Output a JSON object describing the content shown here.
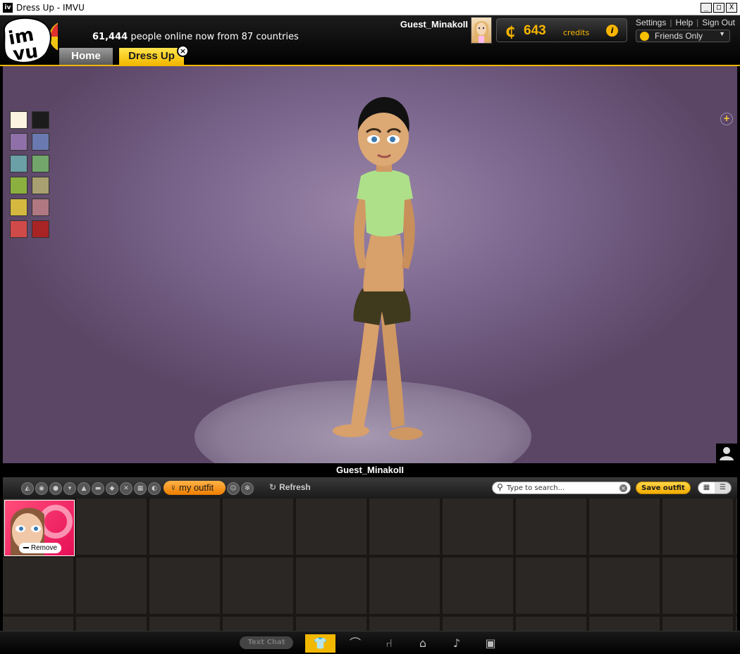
{
  "window": {
    "title": "Dress Up - IMVU",
    "app_icon": "iv",
    "min": "_",
    "max": "□",
    "close": "X"
  },
  "header": {
    "logo_text": "imvu",
    "online_count": "61,444",
    "online_text": "people online now from 87 countries",
    "username": "Guest_MinakoII",
    "credits_symbol": "₵",
    "credits_amount": "643",
    "credits_label": "credits",
    "info_icon": "i",
    "links": [
      "Settings",
      "Help",
      "Sign Out"
    ],
    "status": "Friends Only"
  },
  "tabs": [
    {
      "label": "Home"
    },
    {
      "label": "Dress Up",
      "close": "×"
    }
  ],
  "scene": {
    "swatch_colors": [
      "#fbf4e0",
      "#1c1c1c",
      "#9070a8",
      "#6a7ab0",
      "#6aa0a6",
      "#72a66a",
      "#8cb040",
      "#a8a070",
      "#d4b840",
      "#b07880",
      "#d04a4a",
      "#a82424"
    ],
    "add_button": "+"
  },
  "name_bar": "Guest_MinakoII",
  "toolbar": {
    "category_icons": [
      "hair-icon",
      "eyes-icon",
      "head-icon",
      "top-icon",
      "jacket-icon",
      "bottom-icon",
      "shoes-icon",
      "jewelry-icon",
      "accessory-icon",
      "wings-icon",
      "pet-icon",
      "pose-icon"
    ],
    "my_outfit": "my outfit",
    "refresh": "Refresh",
    "search_placeholder": "Type to search...",
    "save_outfit": "Save outfit"
  },
  "inventory": {
    "items": [
      {
        "remove_label": "Remove"
      }
    ]
  },
  "dock": {
    "text_chat": "Text Chat"
  }
}
